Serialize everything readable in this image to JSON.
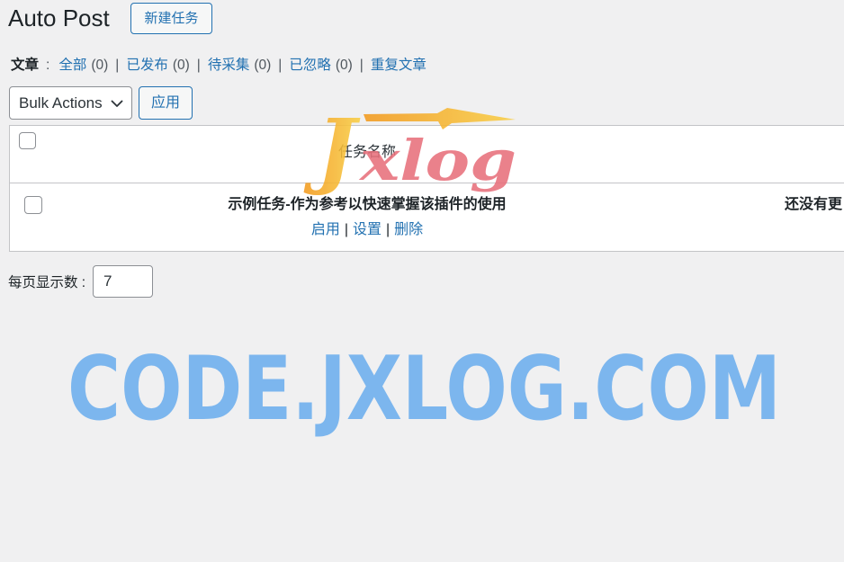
{
  "header": {
    "title": "Auto Post",
    "new_task_label": "新建任务"
  },
  "filters": {
    "group_label": "文章",
    "colon": ":",
    "divider": "|",
    "items": [
      {
        "label": "全部",
        "count": "(0)"
      },
      {
        "label": "已发布",
        "count": "(0)"
      },
      {
        "label": "待采集",
        "count": "(0)"
      },
      {
        "label": "已忽略",
        "count": "(0)"
      },
      {
        "label": "重复文章"
      }
    ]
  },
  "bulk_actions": {
    "selected": "Bulk Actions",
    "apply_label": "应用"
  },
  "table": {
    "columns": {
      "title": "任务名称"
    },
    "action_divider": "|",
    "rows": [
      {
        "title": "示例任务-作为参考以快速掌握该插件的使用",
        "actions": [
          "启用",
          "设置",
          "删除"
        ],
        "status": "还没有更"
      }
    ]
  },
  "pagination": {
    "per_page_label": "每页显示数 :",
    "per_page_value": "7"
  },
  "watermarks": {
    "logo_initial": "J",
    "logo_rest": "xlog",
    "site": "CODE.JXLOG.COM"
  },
  "icons": {
    "bulk_actions_dropdown": "chevron-down-icon",
    "logo_mark": "lightning-bolt-icon"
  },
  "colors": {
    "background": "#f0f0f1",
    "link": "#2271b1",
    "text": "#1d2327",
    "muted": "#50575e",
    "table_border": "#c3c4c7",
    "input_border": "#8c8f94",
    "watermark_blue": "#7cb6ee",
    "logo_pink": "#e8707c",
    "logo_orange": "#f6a62b"
  }
}
